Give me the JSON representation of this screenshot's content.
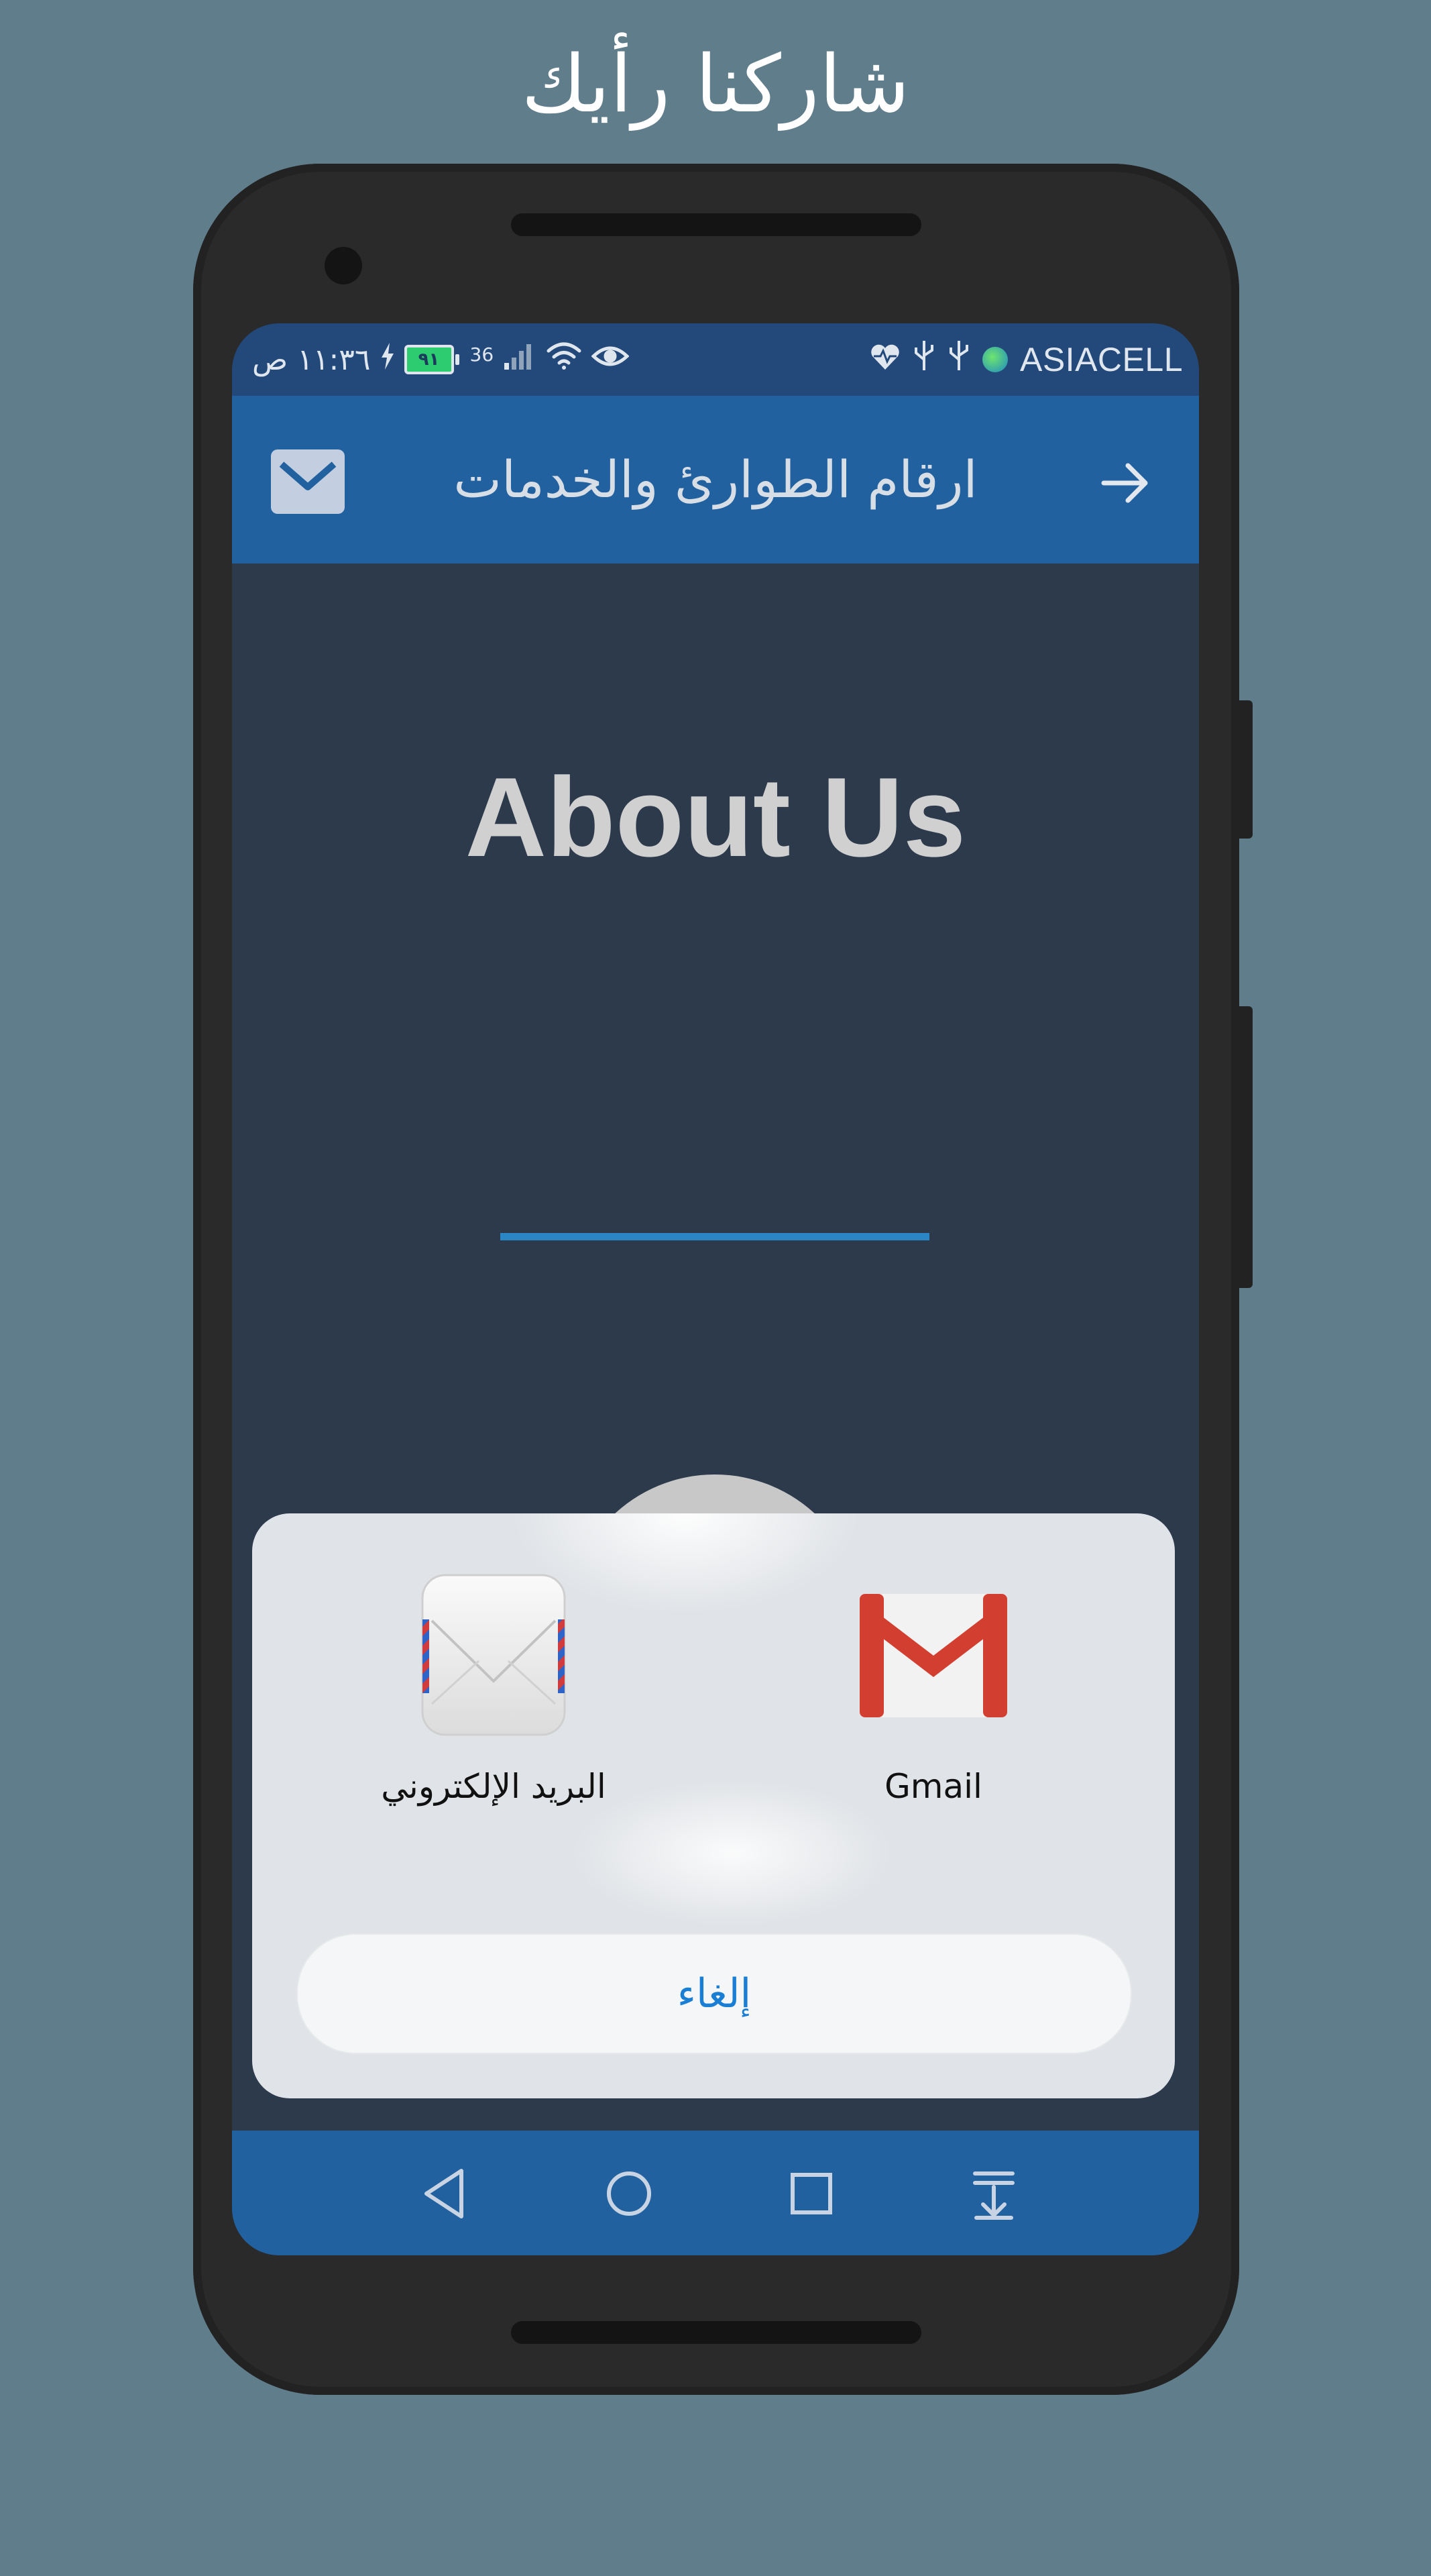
{
  "promo": {
    "title": "شاركنا رأيك"
  },
  "status_bar": {
    "time": "١١:٣٦ ص",
    "battery": "٩١",
    "network": "36",
    "carrier": "ASIACELL"
  },
  "app_bar": {
    "title": "ارقام الطوارئ والخدمات"
  },
  "content": {
    "about_title": "About Us"
  },
  "share_sheet": {
    "items": [
      {
        "label": "البريد الإلكتروني",
        "icon": "email-app-icon"
      },
      {
        "label": "Gmail",
        "icon": "gmail-icon"
      }
    ],
    "cancel_label": "إلغاء"
  },
  "nav": {
    "buttons": [
      "back",
      "home",
      "recents",
      "notifications-pull"
    ]
  },
  "colors": {
    "background": "#607d8b",
    "app_bar": "#2261a0",
    "content_bg": "#2c3a4b",
    "accent_line": "#2b86c5",
    "cancel_text": "#1a7fd4"
  }
}
